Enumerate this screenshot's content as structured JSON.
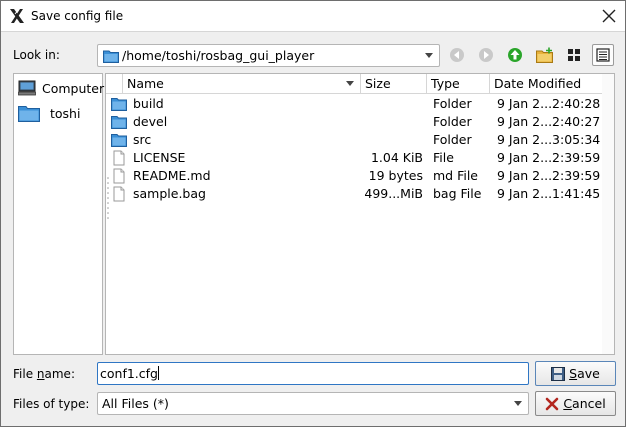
{
  "window": {
    "title": "Save config file",
    "logo_icon": "x11-logo-icon",
    "close_icon": "close-icon"
  },
  "look_in": {
    "label": "Look in:",
    "path": "/home/toshi/rosbag_gui_player"
  },
  "toolbar": {
    "buttons": [
      {
        "name": "back-button",
        "icon": "arrow-left-icon",
        "enabled": false
      },
      {
        "name": "forward-button",
        "icon": "arrow-right-icon",
        "enabled": false
      },
      {
        "name": "parent-directory-button",
        "icon": "arrow-up-green-icon",
        "enabled": true
      },
      {
        "name": "new-folder-button",
        "icon": "new-folder-icon",
        "enabled": true
      },
      {
        "name": "list-view-button",
        "icon": "list-view-icon",
        "enabled": true
      },
      {
        "name": "detail-view-button",
        "icon": "detail-view-icon",
        "enabled": true
      }
    ]
  },
  "sidebar": {
    "items": [
      {
        "label": "Computer",
        "icon": "computer-icon"
      },
      {
        "label": "toshi",
        "icon": "folder-icon"
      }
    ]
  },
  "files": {
    "columns": [
      "Name",
      "Size",
      "Type",
      "Date Modified"
    ],
    "rows": [
      {
        "name": "build",
        "size": "",
        "type": "Folder",
        "date": "9 Jan 2...2:40:28",
        "icon": "folder-icon"
      },
      {
        "name": "devel",
        "size": "",
        "type": "Folder",
        "date": "9 Jan 2...2:40:27",
        "icon": "folder-icon"
      },
      {
        "name": "src",
        "size": "",
        "type": "Folder",
        "date": "9 Jan 2...3:05:34",
        "icon": "folder-icon"
      },
      {
        "name": "LICENSE",
        "size": "1.04 KiB",
        "type": "File",
        "date": "9 Jan 2...2:39:59",
        "icon": "file-icon"
      },
      {
        "name": "README.md",
        "size": "19 bytes",
        "type": "md File",
        "date": "9 Jan 2...2:39:59",
        "icon": "file-icon"
      },
      {
        "name": "sample.bag",
        "size": "499...MiB",
        "type": "bag File",
        "date": "9 Jan 2...1:41:45",
        "icon": "file-icon"
      }
    ]
  },
  "file_name": {
    "label_pre": "File ",
    "label_mnemonic": "n",
    "label_post": "ame:",
    "value": "conf1.cfg"
  },
  "file_type": {
    "label": "Files of type:",
    "value": "All Files (*)"
  },
  "buttons": {
    "save_mnemonic": "S",
    "save_rest": "ave",
    "cancel_mnemonic": "C",
    "cancel_rest": "ancel"
  },
  "colors": {
    "folder": "#3a8fd6",
    "focus_border": "#2f76c4",
    "green_arrow": "#2aa52a"
  }
}
